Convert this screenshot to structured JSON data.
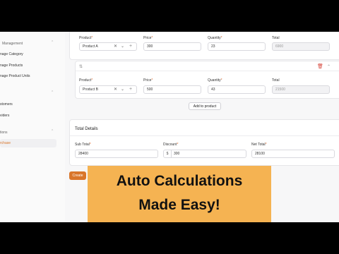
{
  "sidebar": {
    "group_management": "Management",
    "items_management": [
      "nage Category",
      "nage Products",
      "nage Product Units"
    ],
    "items_people": [
      "stomers",
      "viders"
    ],
    "group_transactions": "tions",
    "active_item": "rchase"
  },
  "row1": {
    "product_label": "Product",
    "price_label": "Price",
    "quantity_label": "Quantity",
    "total_label": "Total",
    "product_value": "Product A",
    "price_value": "300",
    "quantity_value": "23",
    "total_value": "6900"
  },
  "row2": {
    "product_label": "Product",
    "price_label": "Price",
    "quantity_label": "Quantity",
    "total_label": "Total",
    "product_value": "Product B",
    "price_value": "500",
    "quantity_value": "43",
    "total_value": "21500"
  },
  "add_product_label": "Add to product",
  "totals": {
    "title": "Total Details",
    "subtotal_label": "Sub Total",
    "subtotal_value": "28400",
    "discount_label": "Discount",
    "discount_prefix": "$",
    "discount_value": "300",
    "nettotal_label": "Net Total",
    "nettotal_value": "28100"
  },
  "create_label": "Create",
  "banner": {
    "line1": "Auto Calculations",
    "line2": "Made Easy!"
  },
  "colors": {
    "accent": "#d9762a",
    "banner": "#f5b352",
    "required": "#e06a2d"
  },
  "icons": [
    "chevron-down-icon",
    "chevron-up-icon",
    "clear-icon",
    "plus-icon",
    "reorder-icon",
    "trash-icon"
  ]
}
